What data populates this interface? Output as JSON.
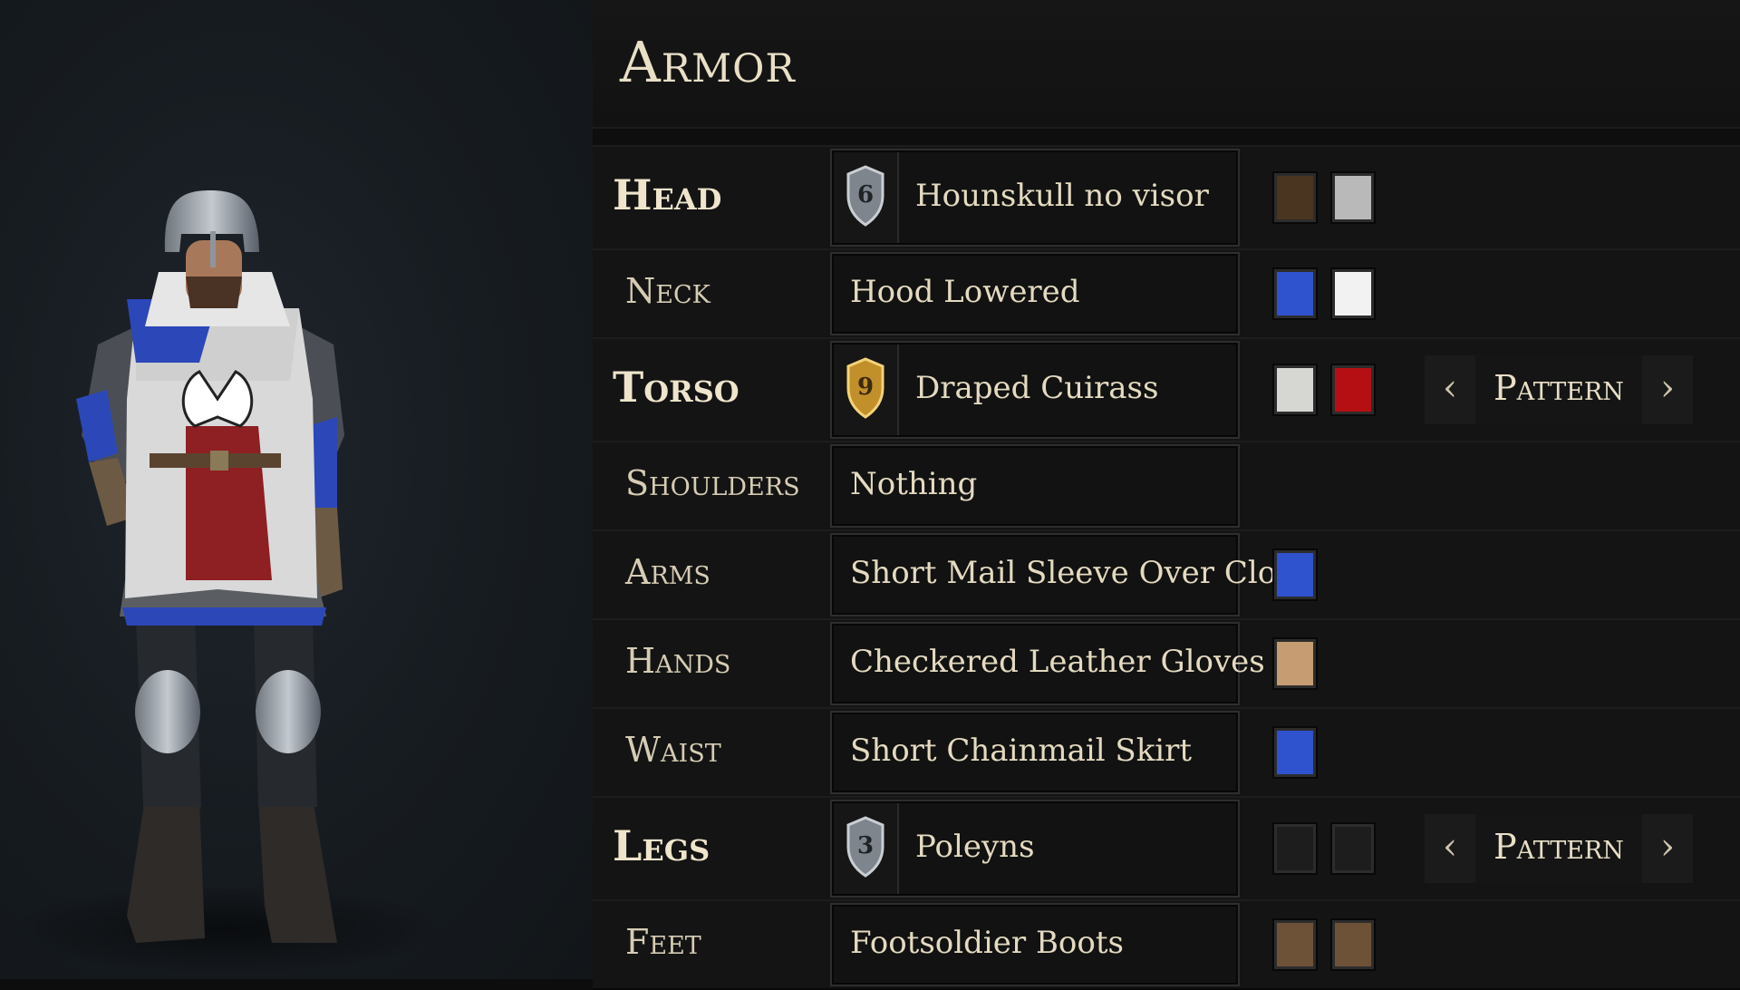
{
  "panel": {
    "title": "Armor"
  },
  "slots": [
    {
      "label": "Head",
      "item": "Hounskull no visor",
      "tier": "6",
      "tier_style": "silver",
      "colors": [
        "#4a3520",
        "#b9b9b9"
      ],
      "pattern_label": ""
    },
    {
      "label": "Neck",
      "item": "Hood Lowered",
      "tier": "",
      "tier_style": "",
      "colors": [
        "#2f52cf",
        "#f2f2f2"
      ],
      "pattern_label": ""
    },
    {
      "label": "Torso",
      "item": "Draped Cuirass",
      "tier": "9",
      "tier_style": "gold",
      "colors": [
        "#d6d6d2",
        "#b50f14"
      ],
      "pattern_label": "Pattern"
    },
    {
      "label": "Shoulders",
      "item": "Nothing",
      "tier": "",
      "tier_style": "",
      "colors": [],
      "pattern_label": ""
    },
    {
      "label": "Arms",
      "item": "Short Mail Sleeve Over Cloth",
      "tier": "",
      "tier_style": "",
      "colors": [
        "#2f52cf"
      ],
      "pattern_label": ""
    },
    {
      "label": "Hands",
      "item": "Checkered Leather Gloves",
      "tier": "",
      "tier_style": "",
      "colors": [
        "#c69c72"
      ],
      "pattern_label": ""
    },
    {
      "label": "Waist",
      "item": "Short Chainmail Skirt",
      "tier": "",
      "tier_style": "",
      "colors": [
        "#2f52cf"
      ],
      "pattern_label": ""
    },
    {
      "label": "Legs",
      "item": "Poleyns",
      "tier": "3",
      "tier_style": "silver",
      "colors": [
        "#1d1d1d",
        "#1d1d1d"
      ],
      "pattern_label": "Pattern"
    },
    {
      "label": "Feet",
      "item": "Footsoldier Boots",
      "tier": "",
      "tier_style": "",
      "colors": [
        "#6e5238",
        "#6e5238"
      ],
      "pattern_label": ""
    }
  ],
  "icons": {
    "prev": "chevron-left-icon",
    "next": "chevron-right-icon",
    "tier": "shield-icon",
    "prev_glyph": "‹",
    "next_glyph": "›"
  },
  "character": {
    "tabard_colors": [
      "#2c47b8",
      "#d9d9d9",
      "#8e1f22"
    ],
    "helmet_color": "#a9b0b7"
  }
}
